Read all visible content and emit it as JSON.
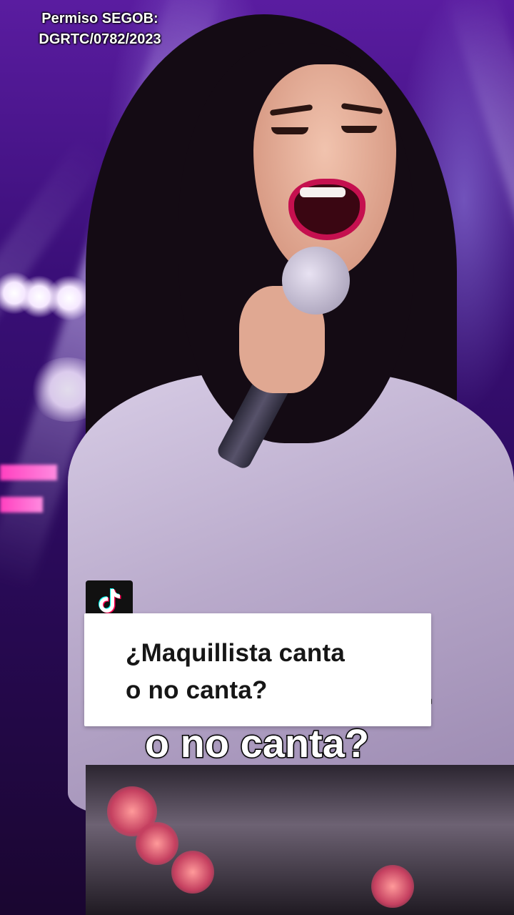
{
  "overlay": {
    "permit_line1": "Permiso SEGOB:",
    "permit_line2": "DGRTC/0782/2023"
  },
  "video_caption": {
    "line1": "¿Maquillista canta",
    "line2": "o no canta?"
  },
  "tiktok_card": {
    "icon": "tiktok-logo-icon",
    "line1": "¿Maquillista canta",
    "line2": "o no canta?"
  },
  "colors": {
    "background": "#3a0f78",
    "lipstick": "#c5104f",
    "card": "#ffffff",
    "badge": "#111111"
  }
}
